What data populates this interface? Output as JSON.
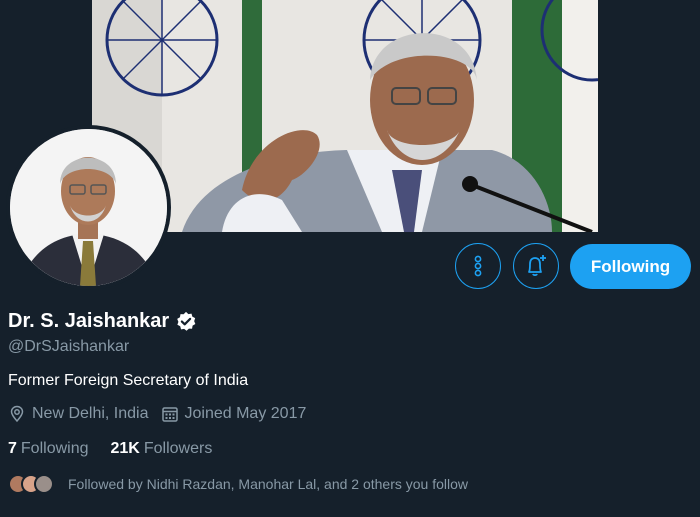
{
  "profile": {
    "name": "Dr. S. Jaishankar",
    "handle": "@DrSJaishankar",
    "bio": "Former Foreign Secretary of India",
    "location": "New Delhi, India",
    "joined": "Joined May 2017",
    "verified": true
  },
  "actions": {
    "following_label": "Following",
    "more_icon": "more-vertical-icon",
    "notify_icon": "bell-plus-icon"
  },
  "stats": {
    "following_count": "7",
    "following_label": "Following",
    "followers_count": "21K",
    "followers_label": "Followers"
  },
  "followed_by": {
    "text": "Followed by Nidhi Razdan, Manohar Lal, and 2 others you follow"
  },
  "colors": {
    "background": "#15202b",
    "accent": "#1da1f2",
    "secondary_text": "#8899a6"
  }
}
